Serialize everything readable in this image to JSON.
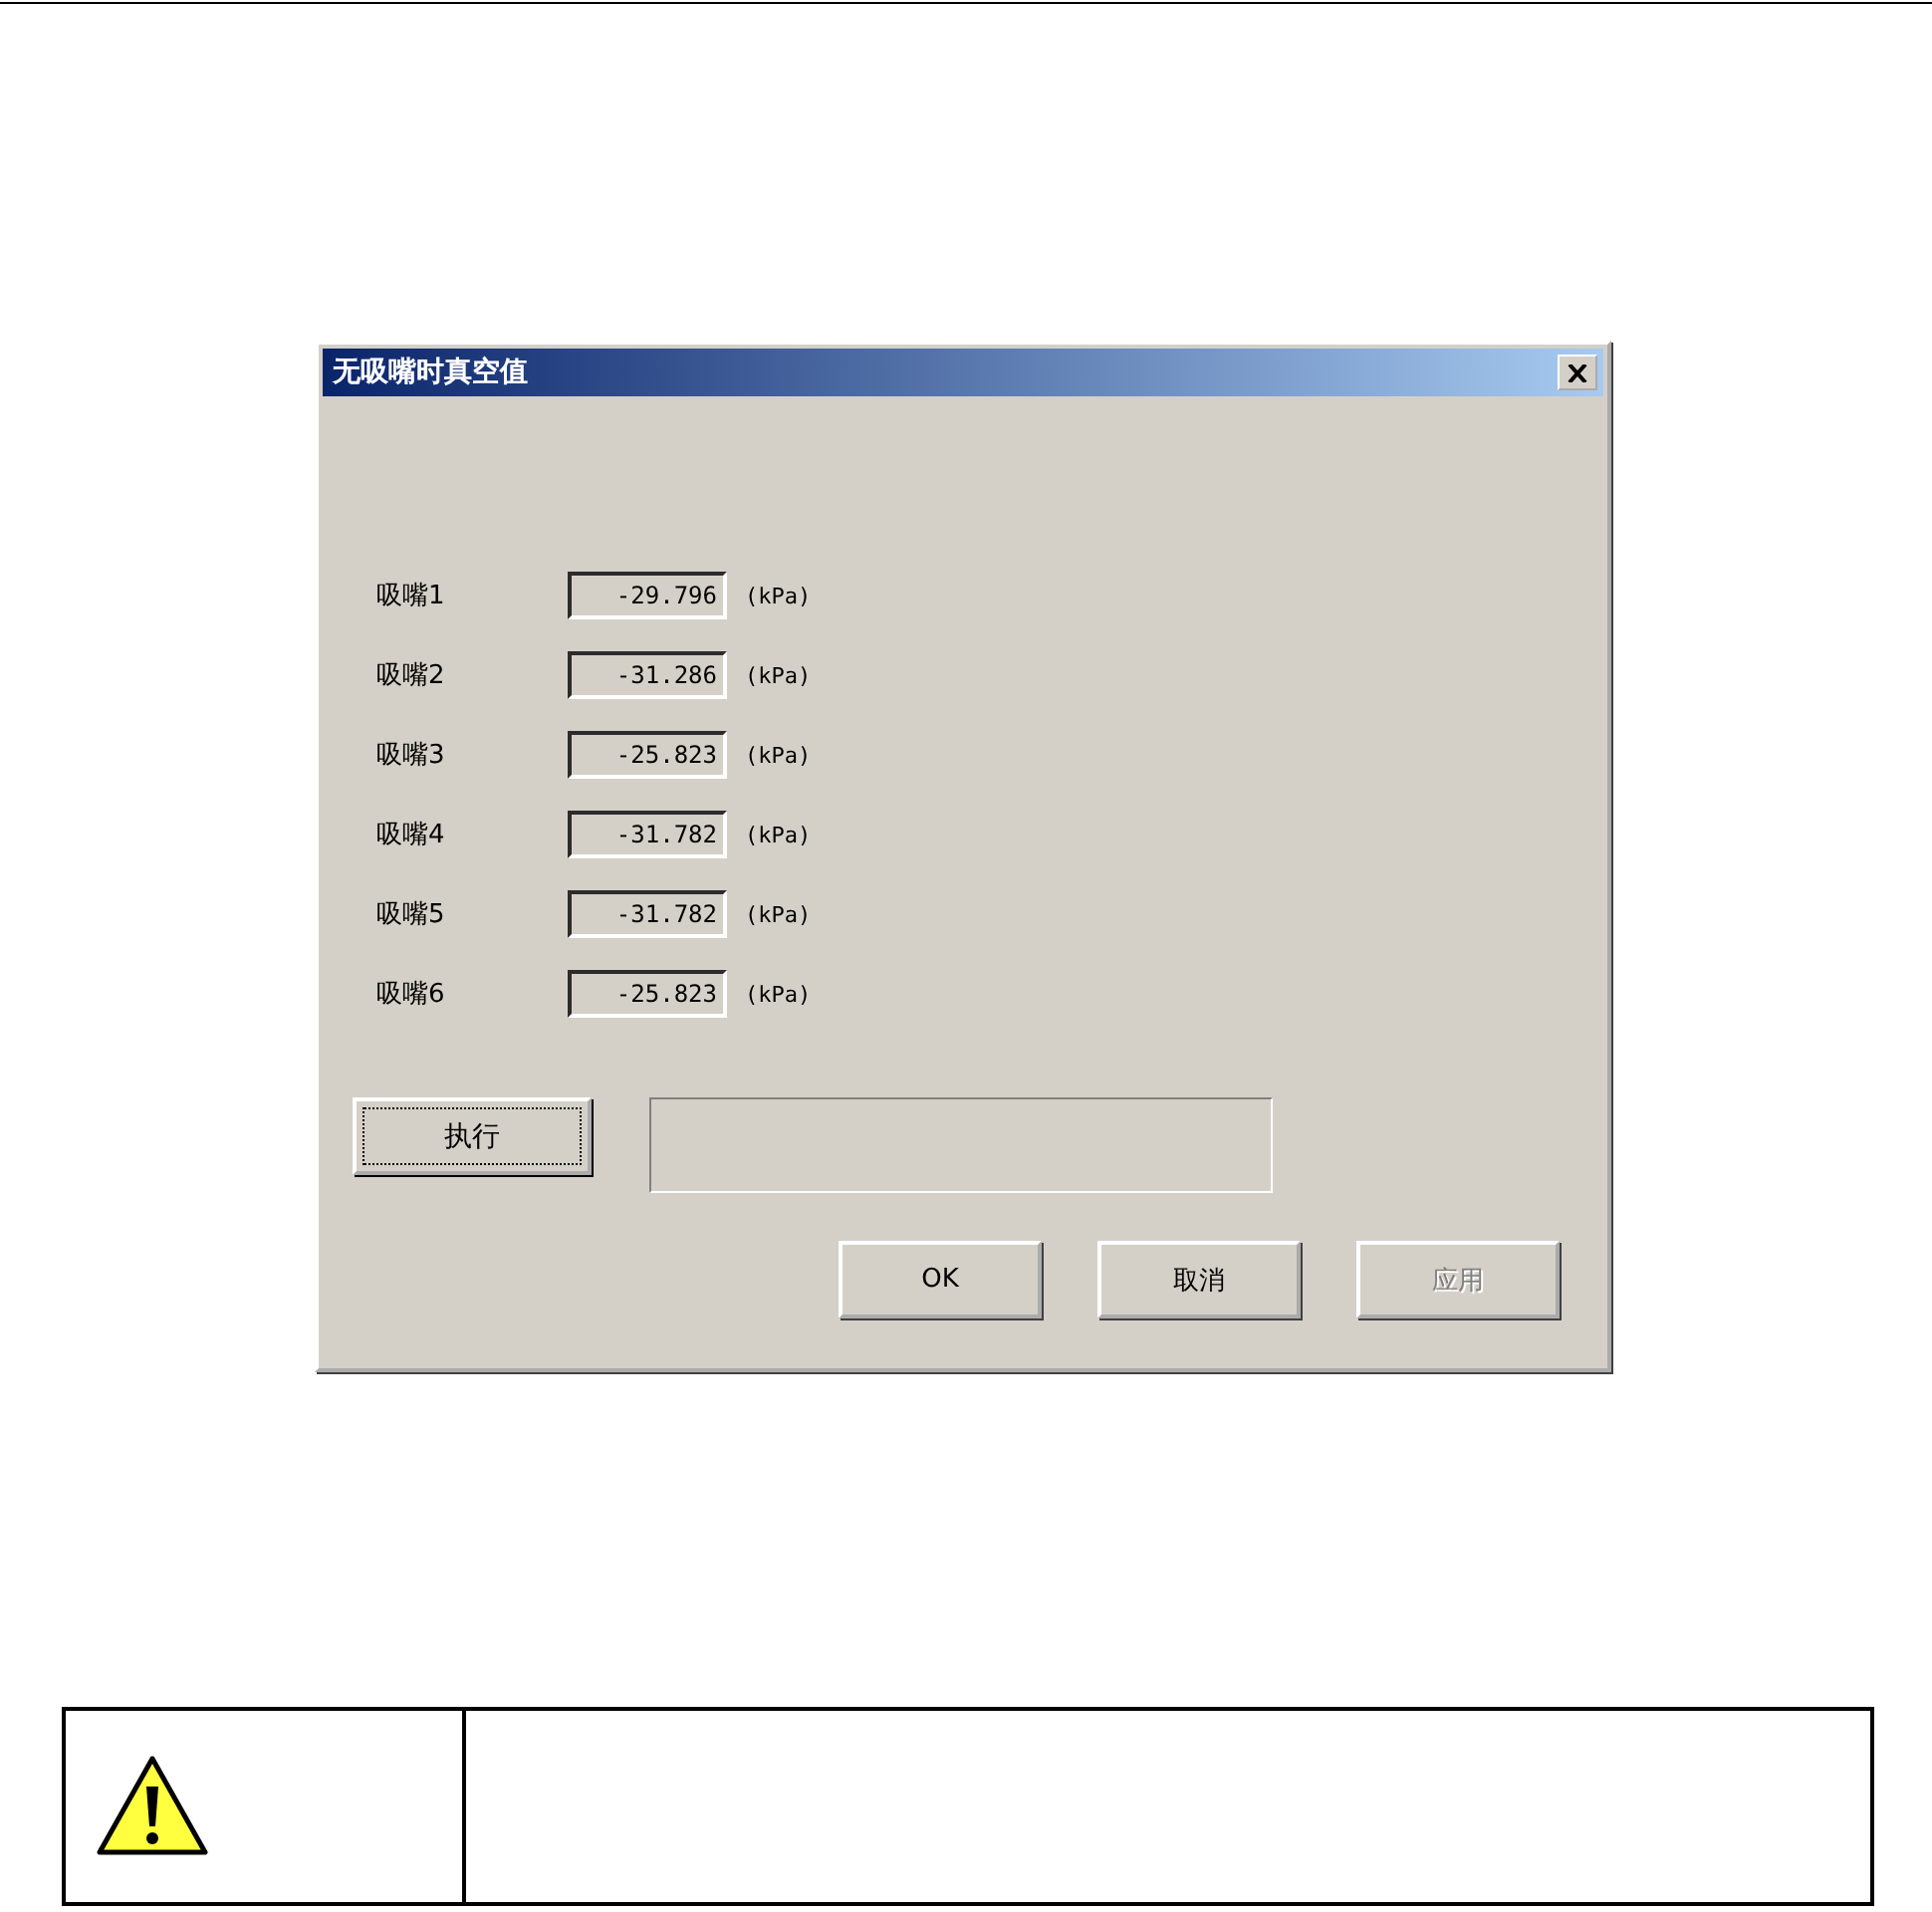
{
  "dialog": {
    "title": "无吸嘴时真空值",
    "rows": [
      {
        "label": "吸嘴1",
        "value": "-29.796",
        "unit": "(kPa)"
      },
      {
        "label": "吸嘴2",
        "value": "-31.286",
        "unit": "(kPa)"
      },
      {
        "label": "吸嘴3",
        "value": "-25.823",
        "unit": "(kPa)"
      },
      {
        "label": "吸嘴4",
        "value": "-31.782",
        "unit": "(kPa)"
      },
      {
        "label": "吸嘴5",
        "value": "-31.782",
        "unit": "(kPa)"
      },
      {
        "label": "吸嘴6",
        "value": "-25.823",
        "unit": "(kPa)"
      }
    ],
    "execute_button": {
      "label": "执行",
      "focused": true
    },
    "buttons": [
      {
        "label": "OK",
        "disabled": false
      },
      {
        "label": "取消",
        "disabled": false
      },
      {
        "label": "应用",
        "disabled": true
      }
    ]
  }
}
